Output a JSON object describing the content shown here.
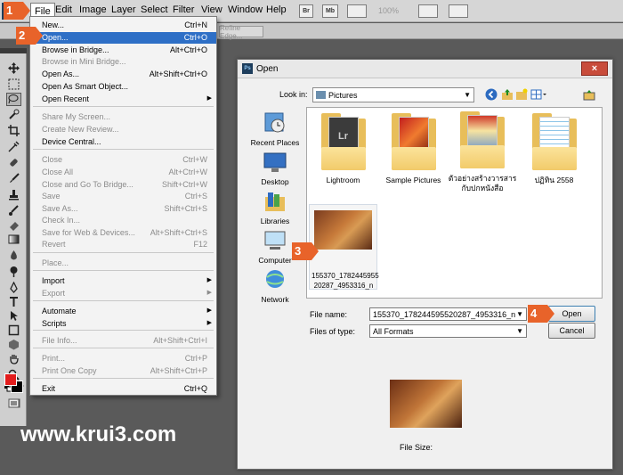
{
  "menubar": {
    "logo": "Ps",
    "items": [
      "File",
      "Edit",
      "Image",
      "Layer",
      "Select",
      "Filter",
      "View",
      "Window",
      "Help"
    ],
    "toolbar_icons": [
      {
        "name": "bridge-icon",
        "label": "Br"
      },
      {
        "name": "mini-bridge-icon",
        "label": "Mb"
      },
      {
        "name": "film-icon",
        "label": ""
      },
      {
        "name": "layout-icon",
        "label": ""
      },
      {
        "name": "screen-mode-icon",
        "label": ""
      }
    ],
    "zoom": "100%"
  },
  "optbar": {
    "refine_edge": "Refine Edge..."
  },
  "file_menu": {
    "items": [
      {
        "label": "New...",
        "shortcut": "Ctrl+N",
        "state": "normal"
      },
      {
        "label": "Open...",
        "shortcut": "Ctrl+O",
        "state": "highlighted"
      },
      {
        "label": "Browse in Bridge...",
        "shortcut": "Alt+Ctrl+O",
        "state": "normal"
      },
      {
        "label": "Browse in Mini Bridge...",
        "shortcut": "",
        "state": "disabled"
      },
      {
        "label": "Open As...",
        "shortcut": "Alt+Shift+Ctrl+O",
        "state": "normal"
      },
      {
        "label": "Open As Smart Object...",
        "shortcut": "",
        "state": "normal"
      },
      {
        "label": "Open Recent",
        "shortcut": "",
        "state": "submenu"
      },
      {
        "label": "Share My Screen...",
        "shortcut": "",
        "state": "disabled"
      },
      {
        "label": "Create New Review...",
        "shortcut": "",
        "state": "disabled"
      },
      {
        "label": "Device Central...",
        "shortcut": "",
        "state": "normal"
      },
      {
        "label": "Close",
        "shortcut": "Ctrl+W",
        "state": "disabled"
      },
      {
        "label": "Close All",
        "shortcut": "Alt+Ctrl+W",
        "state": "disabled"
      },
      {
        "label": "Close and Go To Bridge...",
        "shortcut": "Shift+Ctrl+W",
        "state": "disabled"
      },
      {
        "label": "Save",
        "shortcut": "Ctrl+S",
        "state": "disabled"
      },
      {
        "label": "Save As...",
        "shortcut": "Shift+Ctrl+S",
        "state": "disabled"
      },
      {
        "label": "Check In...",
        "shortcut": "",
        "state": "disabled"
      },
      {
        "label": "Save for Web & Devices...",
        "shortcut": "Alt+Shift+Ctrl+S",
        "state": "disabled"
      },
      {
        "label": "Revert",
        "shortcut": "F12",
        "state": "disabled"
      },
      {
        "label": "Place...",
        "shortcut": "",
        "state": "disabled"
      },
      {
        "label": "Import",
        "shortcut": "",
        "state": "submenu"
      },
      {
        "label": "Export",
        "shortcut": "",
        "state": "disabled-submenu"
      },
      {
        "label": "Automate",
        "shortcut": "",
        "state": "submenu"
      },
      {
        "label": "Scripts",
        "shortcut": "",
        "state": "submenu"
      },
      {
        "label": "File Info...",
        "shortcut": "Alt+Shift+Ctrl+I",
        "state": "disabled"
      },
      {
        "label": "Print...",
        "shortcut": "Ctrl+P",
        "state": "disabled"
      },
      {
        "label": "Print One Copy",
        "shortcut": "Alt+Shift+Ctrl+P",
        "state": "disabled"
      },
      {
        "label": "Exit",
        "shortcut": "Ctrl+Q",
        "state": "normal"
      }
    ]
  },
  "dialog": {
    "title": "Open",
    "close": "×",
    "look_in_label": "Look in:",
    "look_in_value": "Pictures",
    "places": [
      "Recent Places",
      "Desktop",
      "Libraries",
      "Computer",
      "Network"
    ],
    "files": [
      {
        "name": "Lightroom"
      },
      {
        "name": "Sample Pictures"
      },
      {
        "name": "ตัวอย่างสร้างวารสารกับปกหนังสือ"
      },
      {
        "name": "ปฏิทิน 2558"
      },
      {
        "name": "155370_1782445955 20287_4953316_n"
      }
    ],
    "file_name_label": "File name:",
    "file_name_value": "155370_178244595520287_4953316_n",
    "files_of_type_label": "Files of type:",
    "files_of_type_value": "All Formats",
    "open_button": "Open",
    "cancel_button": "Cancel",
    "file_size_label": "File Size:"
  },
  "steps": [
    "1",
    "2",
    "3",
    "4"
  ],
  "watermark": "www.krui3.com",
  "colors": {
    "foreground": "#e21c1c",
    "background": "#000000",
    "highlight": "#2e6fc6",
    "step_marker": "#e8632a"
  }
}
